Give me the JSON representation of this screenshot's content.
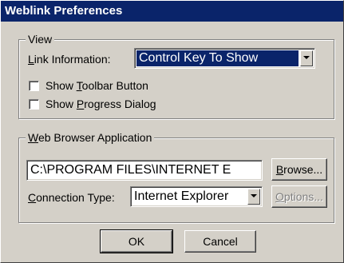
{
  "dialog": {
    "title": "Weblink Preferences"
  },
  "view_group": {
    "legend": "View",
    "link_info_label_prefix": "",
    "link_info_label_u": "L",
    "link_info_label_rest": "ink Information:",
    "link_info_value": "Control Key To Show",
    "show_toolbar_prefix": "Show ",
    "show_toolbar_u": "T",
    "show_toolbar_rest": "oolbar Button",
    "show_toolbar_checked": false,
    "show_progress_prefix": "Show ",
    "show_progress_u": "P",
    "show_progress_rest": "rogress Dialog",
    "show_progress_checked": false
  },
  "browser_group": {
    "legend_u": "W",
    "legend_rest": "eb Browser Application",
    "path_value": "C:\\PROGRAM FILES\\INTERNET E",
    "browse_u": "B",
    "browse_rest": "rowse...",
    "connection_u": "C",
    "connection_rest": "onnection Type:",
    "connection_value": "Internet Explorer",
    "options_u": "O",
    "options_rest": "ptions...",
    "options_enabled": false
  },
  "footer": {
    "ok_label": "OK",
    "cancel_label": "Cancel"
  }
}
